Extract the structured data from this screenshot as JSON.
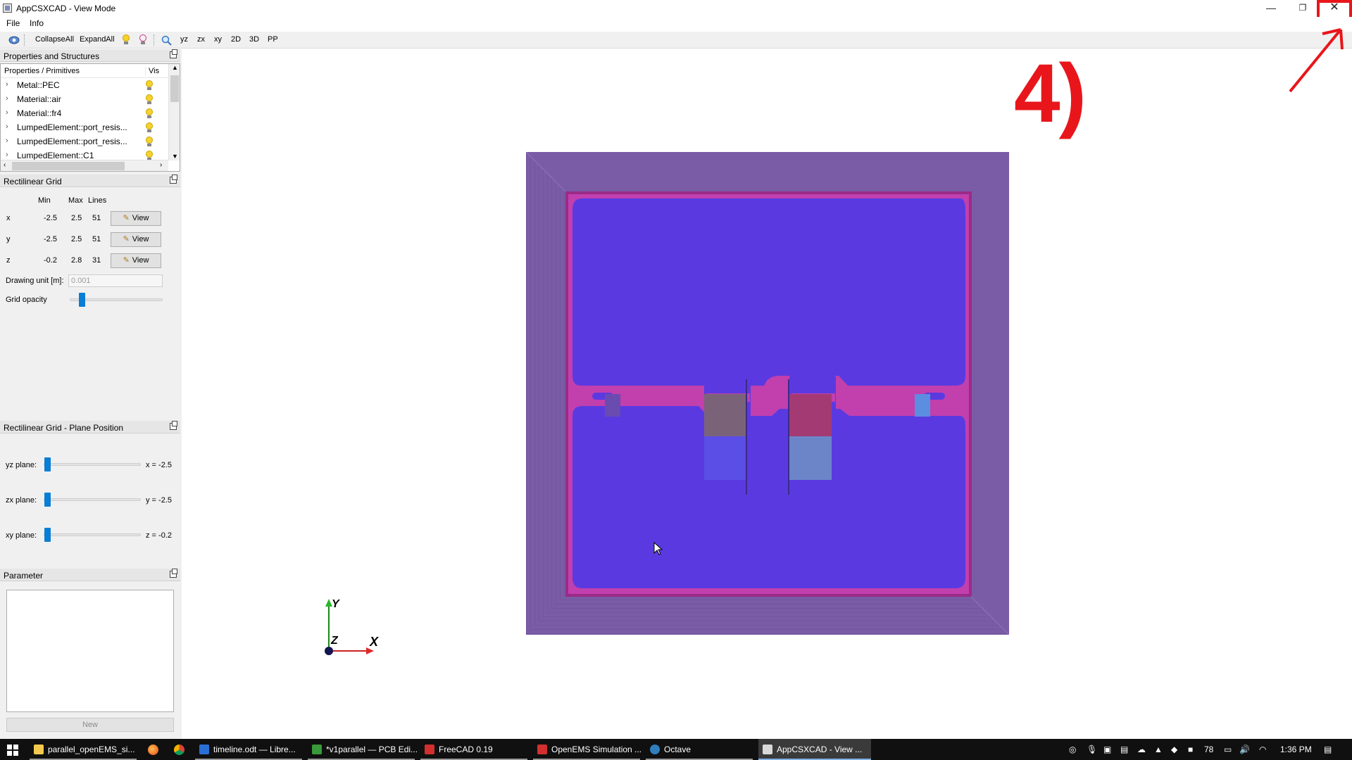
{
  "window": {
    "title": "AppCSXCAD - View Mode",
    "minimize": "—",
    "maximize": "❐",
    "close": "✕"
  },
  "menu": {
    "file": "File",
    "info": "Info"
  },
  "toolbar": {
    "collapse_all": "CollapseAll",
    "expand_all": "ExpandAll",
    "yz": "yz",
    "zx": "zx",
    "xy": "xy",
    "view2d": "2D",
    "view3d": "3D",
    "pp": "PP"
  },
  "properties_panel": {
    "title": "Properties and Structures",
    "col_primitives": "Properties / Primitives",
    "col_vis": "Vis",
    "items": [
      {
        "label": "Metal::PEC"
      },
      {
        "label": "Material::air"
      },
      {
        "label": "Material::fr4"
      },
      {
        "label": "LumpedElement::port_resis..."
      },
      {
        "label": "LumpedElement::port_resis..."
      },
      {
        "label": "LumpedElement::C1"
      }
    ]
  },
  "grid_panel": {
    "title": "Rectilinear Grid",
    "col_min": "Min",
    "col_max": "Max",
    "col_lines": "Lines",
    "view_label": "View",
    "rows": [
      {
        "axis": "x",
        "min": "-2.5",
        "max": "2.5",
        "lines": "51"
      },
      {
        "axis": "y",
        "min": "-2.5",
        "max": "2.5",
        "lines": "51"
      },
      {
        "axis": "z",
        "min": "-0.2",
        "max": "2.8",
        "lines": "31"
      }
    ],
    "drawing_unit_label": "Drawing unit [m]:",
    "drawing_unit_value": "0.001",
    "opacity_label": "Grid opacity"
  },
  "plane_panel": {
    "title": "Rectilinear Grid - Plane Position",
    "planes": [
      {
        "label": "yz plane:",
        "value": "x = -2.5"
      },
      {
        "label": "zx plane:",
        "value": "y = -2.5"
      },
      {
        "label": "xy plane:",
        "value": "z = -0.2"
      }
    ]
  },
  "parameter_panel": {
    "title": "Parameter",
    "new_label": "New"
  },
  "axes": {
    "y": "Y",
    "z": "Z",
    "x": "X"
  },
  "annotation": {
    "step": "4)"
  },
  "taskbar": {
    "items": [
      {
        "label": "parallel_openEMS_si..."
      },
      {
        "label": "timeline.odt — Libre..."
      },
      {
        "label": "*v1parallel — PCB Edi..."
      },
      {
        "label": "FreeCAD 0.19"
      },
      {
        "label": "OpenEMS Simulation ..."
      },
      {
        "label": "Octave"
      },
      {
        "label": "AppCSXCAD - View ..."
      }
    ],
    "tray_number": "78",
    "time": "1:36 PM"
  },
  "colors": {
    "accent": "#0a7dd4",
    "annotation_red": "#e8161b",
    "substrate": "#5a3ae0",
    "boundary": "#7a5ca6",
    "trace": "#c23fae"
  }
}
